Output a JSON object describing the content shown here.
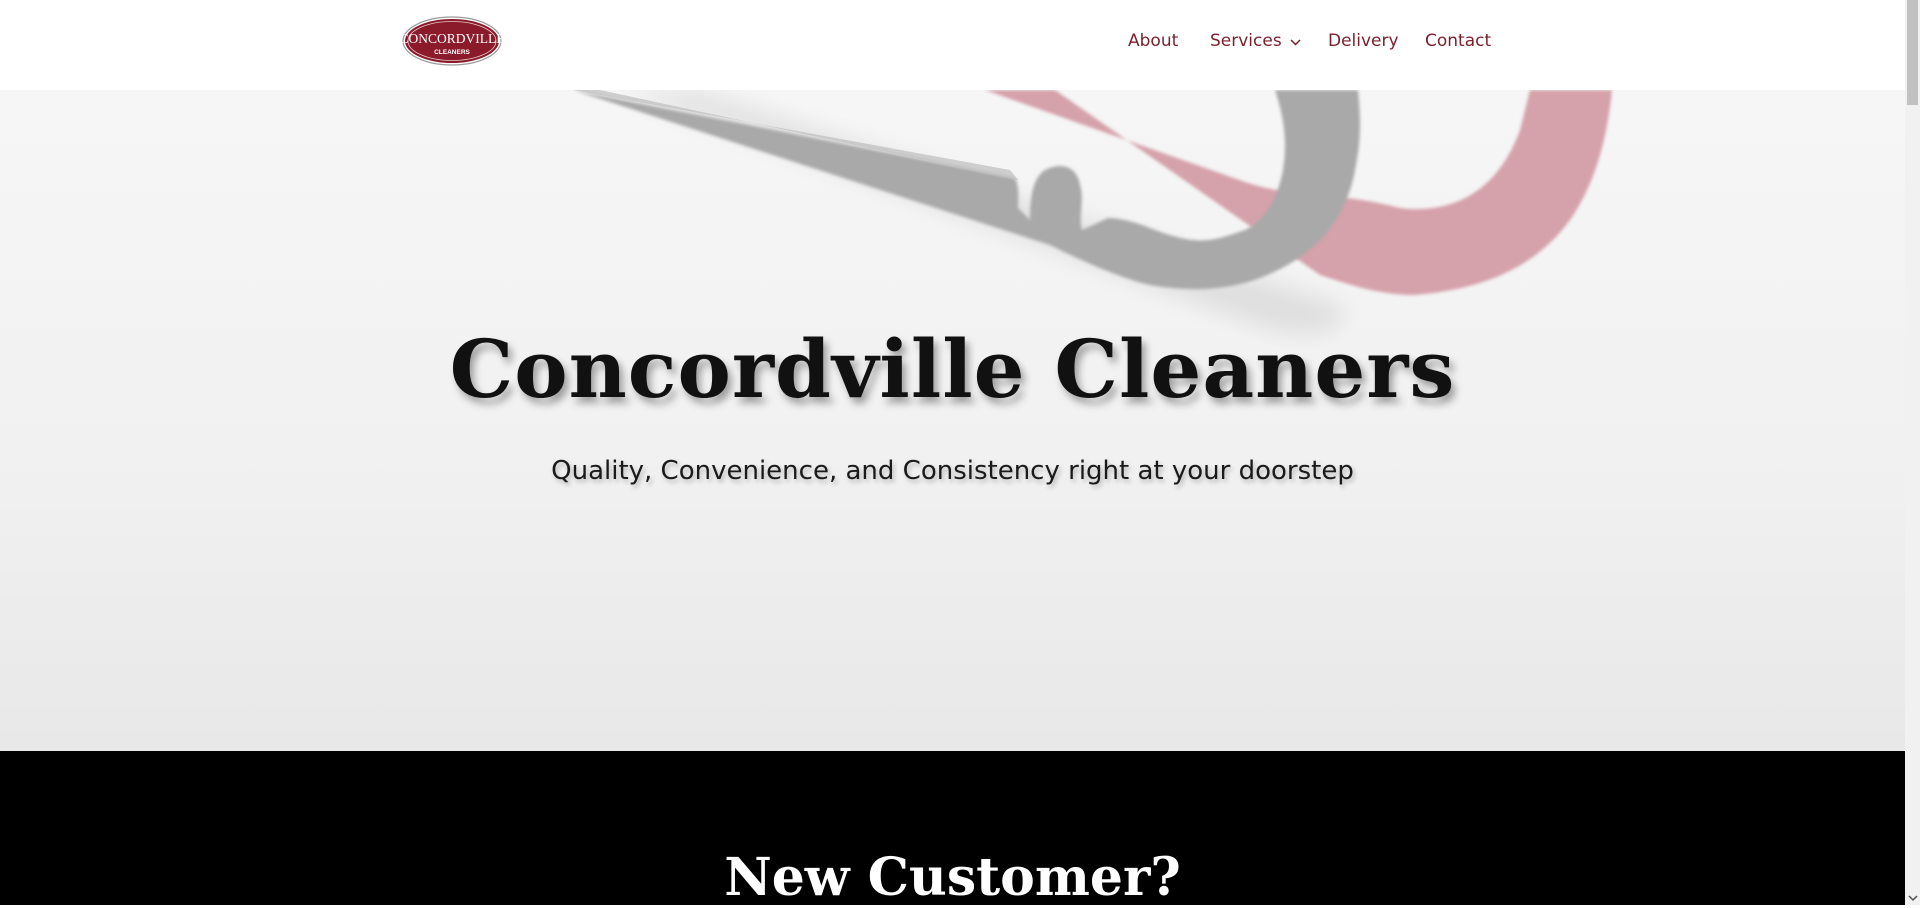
{
  "logo": {
    "line1": "CONCORDVILLE",
    "line2": "CLEANERS"
  },
  "nav": [
    {
      "label": "About"
    },
    {
      "label": "Services",
      "has_dropdown": true
    },
    {
      "label": "Delivery"
    },
    {
      "label": "Contact"
    }
  ],
  "hero": {
    "title": "Concordville Cleaners",
    "subtitle": "Quality, Convenience, and Consistency right at your doorstep"
  },
  "new_customer": {
    "title": "New Customer?"
  },
  "colors": {
    "brand": "#8b1a2a",
    "nav_text": "#7b1f2b",
    "hero_bg": "#f2f2f2",
    "dark_section": "#000000"
  },
  "icons": {
    "dropdown": "chevron-down-icon",
    "scroll_down": "arrow-down-icon"
  }
}
